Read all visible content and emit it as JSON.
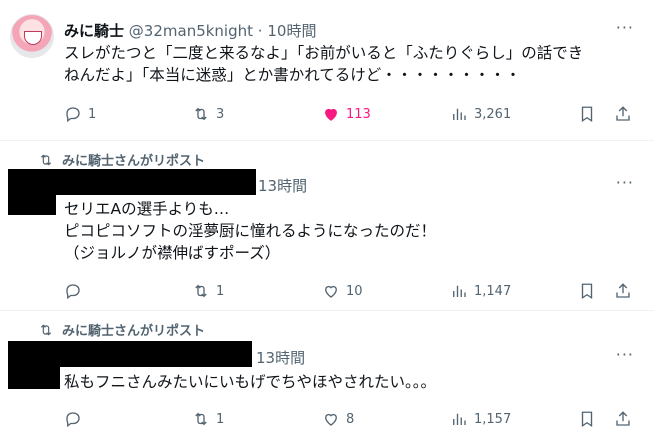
{
  "tweets": [
    {
      "display_name": "みに騎士",
      "handle": "@32man5knight",
      "separator": "·",
      "time": "10時間",
      "text_lines": [
        "スレがたつと「二度と来るなよ」「お前がいると「ふたりぐらし」の話でき",
        "ねんだよ」「本当に迷惑」とか書かれてるけど・・・・・・・・・"
      ],
      "reply_count": "1",
      "retweet_count": "3",
      "like_count": "113",
      "view_count": "3,261",
      "liked": true
    },
    {
      "repost_label": "みに騎士さんがリポスト",
      "time": "13時間",
      "text_lines": [
        "セリエAの選手よりも…",
        "ピコピコソフトの淫夢厨に憧れるようになったのだ！",
        "（ジョルノが襟伸ばすポーズ）"
      ],
      "reply_count": "",
      "retweet_count": "1",
      "like_count": "10",
      "view_count": "1,147"
    },
    {
      "repost_label": "みに騎士さんがリポスト",
      "time": "13時間",
      "text_lines": [
        "私もフニさんみたいにいもげでちやほやされたい。。。"
      ],
      "reply_count": "",
      "retweet_count": "1",
      "like_count": "8",
      "view_count": "1,157"
    }
  ],
  "more_label": "···",
  "icons": [
    "reply-icon",
    "retweet-icon",
    "heart-icon",
    "views-icon",
    "bookmark-icon",
    "share-icon"
  ],
  "colors": {
    "like_active": "#f91880",
    "muted": "#536471",
    "text": "#0f1419"
  }
}
